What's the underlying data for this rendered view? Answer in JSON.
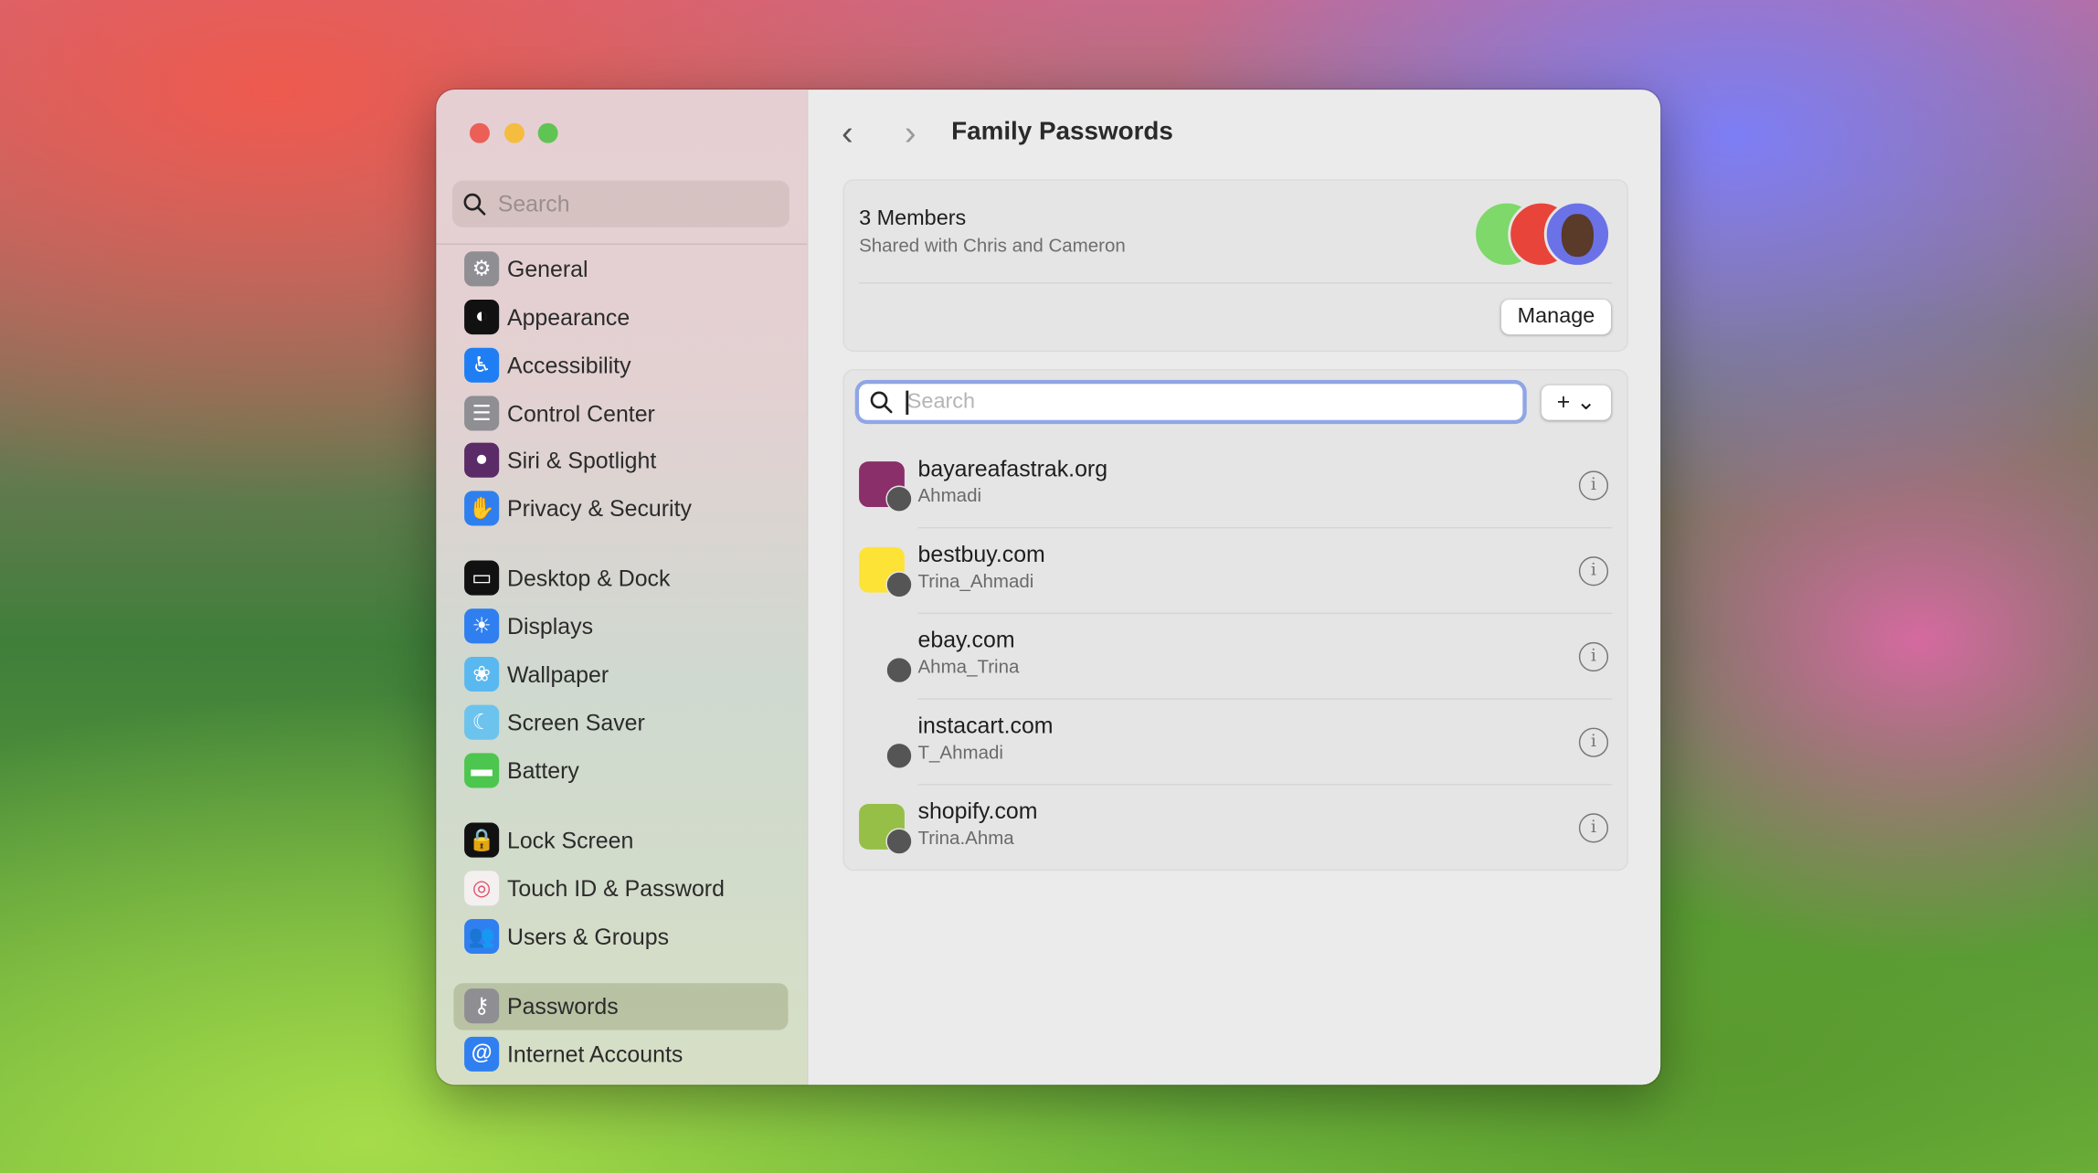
{
  "window": {
    "traffic_lights": {
      "close": "#ec5f57",
      "minimize": "#f4bd3f",
      "zoom": "#5fc454"
    }
  },
  "sidebar": {
    "search_placeholder": "Search",
    "selected": "Passwords",
    "items": [
      {
        "label": "General",
        "icon": "gear-icon",
        "color": "#8e8e93"
      },
      {
        "label": "Appearance",
        "icon": "appearance-icon",
        "color": "#111111"
      },
      {
        "label": "Accessibility",
        "icon": "accessibility-icon",
        "color": "#1f7ef3"
      },
      {
        "label": "Control Center",
        "icon": "control-center-icon",
        "color": "#8e8e93"
      },
      {
        "label": "Siri & Spotlight",
        "icon": "siri-icon",
        "color": "#5a2b66"
      },
      {
        "label": "Privacy & Security",
        "icon": "hand-icon",
        "color": "#2f80ee"
      },
      {
        "label": "Desktop & Dock",
        "icon": "dock-icon",
        "color": "#111111"
      },
      {
        "label": "Displays",
        "icon": "sun-icon",
        "color": "#2f7ff0"
      },
      {
        "label": "Wallpaper",
        "icon": "flower-icon",
        "color": "#5ab8f0"
      },
      {
        "label": "Screen Saver",
        "icon": "screen-saver-icon",
        "color": "#6cc3ee"
      },
      {
        "label": "Battery",
        "icon": "battery-icon",
        "color": "#4cc64e"
      },
      {
        "label": "Lock Screen",
        "icon": "lock-icon",
        "color": "#111111"
      },
      {
        "label": "Touch ID & Password",
        "icon": "fingerprint-icon",
        "color": "#f4f0f0"
      },
      {
        "label": "Users & Groups",
        "icon": "users-icon",
        "color": "#2f7ff0"
      },
      {
        "label": "Passwords",
        "icon": "key-icon",
        "color": "#8e8e93"
      },
      {
        "label": "Internet Accounts",
        "icon": "at-icon",
        "color": "#2f7ff0"
      }
    ]
  },
  "header": {
    "title": "Family Passwords"
  },
  "group": {
    "members_label": "3 Members",
    "shared_with": "Shared with Chris and Cameron",
    "avatar_colors": [
      "#7ed86a",
      "#e8443a",
      "#6b72e8"
    ],
    "manage_label": "Manage"
  },
  "passwords": {
    "search_placeholder": "Search",
    "add_label": "+ ⌄",
    "items": [
      {
        "site": "bayareafastrak.org",
        "user": "Ahmadi",
        "icon_color": "#8a2f6a"
      },
      {
        "site": "bestbuy.com",
        "user": "Trina_Ahmadi",
        "icon_color": "#fde336"
      },
      {
        "site": "ebay.com",
        "user": "Ahma_Trina",
        "icon_color": "#e6e5e5"
      },
      {
        "site": "instacart.com",
        "user": "T_Ahmadi",
        "icon_color": "#e6e5e5"
      },
      {
        "site": "shopify.com",
        "user": "Trina.Ahma",
        "icon_color": "#95bf47"
      }
    ]
  }
}
